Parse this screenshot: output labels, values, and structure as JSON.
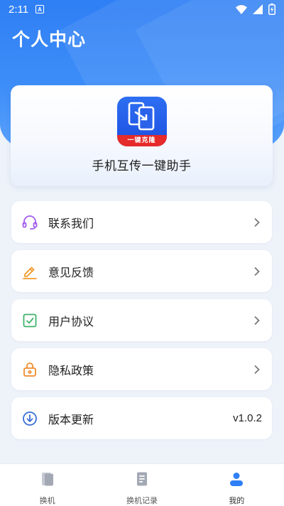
{
  "status_bar": {
    "time": "2:11",
    "notification_glyph": "A"
  },
  "header": {
    "title": "个人中心"
  },
  "profile": {
    "logo_ribbon_text": "一键克隆",
    "app_name": "手机互传一键助手"
  },
  "menu": [
    {
      "label": "联系我们",
      "icon": "headset-icon",
      "icon_color": "#a35cf0"
    },
    {
      "label": "意见反馈",
      "icon": "pencil-icon",
      "icon_color": "#f29a2c"
    },
    {
      "label": "用户协议",
      "icon": "check-square-icon",
      "icon_color": "#3fb36b"
    },
    {
      "label": "隐私政策",
      "icon": "lock-icon",
      "icon_color": "#f08c2a"
    },
    {
      "label": "版本更新",
      "icon": "download-circle-icon",
      "icon_color": "#3a6fd8",
      "value": "v1.0.2"
    }
  ],
  "tabs": [
    {
      "label": "换机",
      "icon": "phone-icon",
      "active": false
    },
    {
      "label": "换机记录",
      "icon": "records-icon",
      "active": false
    },
    {
      "label": "我的",
      "icon": "user-icon",
      "active": true
    }
  ],
  "colors": {
    "primary": "#2f7ff5",
    "background": "#eef2f9",
    "chevron": "#777777"
  }
}
